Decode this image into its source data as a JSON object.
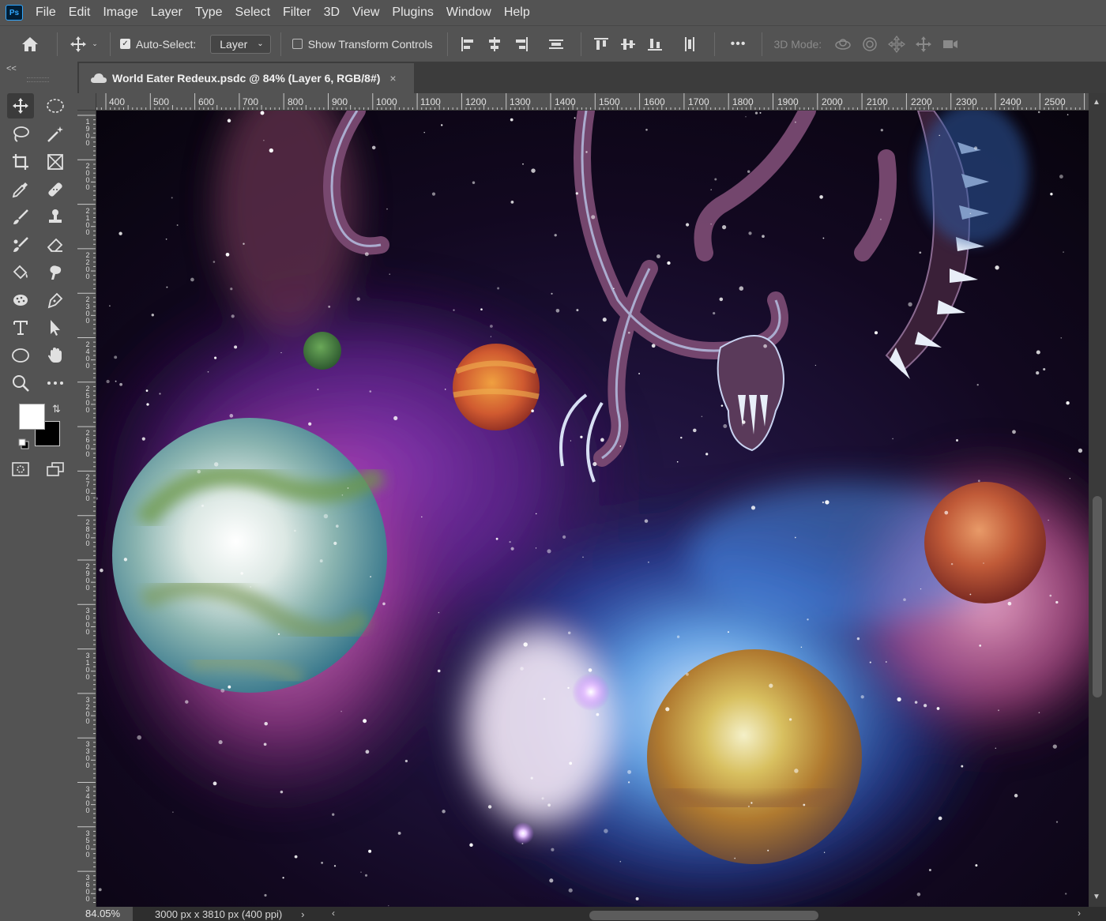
{
  "app": {
    "logo": "Ps"
  },
  "menu": [
    "File",
    "Edit",
    "Image",
    "Layer",
    "Type",
    "Select",
    "Filter",
    "3D",
    "View",
    "Plugins",
    "Window",
    "Help"
  ],
  "options": {
    "auto_select_label": "Auto-Select:",
    "auto_select_checked": true,
    "auto_select_target": "Layer",
    "transform_controls_label": "Show Transform Controls",
    "transform_controls_checked": false,
    "more_label": "•••",
    "mode_label": "3D Mode:"
  },
  "panel": {
    "collapse_label": "<<"
  },
  "document": {
    "tab_title": "World Eater Redeux.psdc @ 84% (Layer 6, RGB/8#)",
    "close_label": "×"
  },
  "ruler_h": [
    "400",
    "500",
    "600",
    "700",
    "800",
    "900",
    "1000",
    "1100",
    "1200",
    "1300",
    "1400",
    "1500",
    "1600",
    "1700",
    "1800",
    "1900",
    "2000",
    "2100",
    "2200",
    "2300",
    "2400",
    "2500"
  ],
  "ruler_v": [
    "1900",
    "2000",
    "2100",
    "2200",
    "2300",
    "2400",
    "2500",
    "2600",
    "2700",
    "2800",
    "2900",
    "3000",
    "3100",
    "3200",
    "3300",
    "3400",
    "3500",
    "3600"
  ],
  "colors": {
    "foreground": "#ffffff",
    "background": "#000000",
    "ui_panel": "#535353",
    "ui_dark": "#282828"
  },
  "status": {
    "zoom": "84.05%",
    "doc_info": "3000 px x 3810 px (400 ppi)",
    "arrow": "›"
  },
  "tools": [
    {
      "name": "move-tool-icon"
    },
    {
      "name": "marquee-tool-icon"
    },
    {
      "name": "lasso-tool-icon"
    },
    {
      "name": "magic-wand-tool-icon"
    },
    {
      "name": "crop-tool-icon"
    },
    {
      "name": "frame-tool-icon"
    },
    {
      "name": "eyedropper-tool-icon"
    },
    {
      "name": "healing-brush-tool-icon"
    },
    {
      "name": "brush-tool-icon"
    },
    {
      "name": "clone-stamp-tool-icon"
    },
    {
      "name": "mixer-brush-tool-icon"
    },
    {
      "name": "eraser-tool-icon"
    },
    {
      "name": "paint-bucket-tool-icon"
    },
    {
      "name": "smudge-tool-icon"
    },
    {
      "name": "sponge-tool-icon"
    },
    {
      "name": "pen-tool-icon"
    },
    {
      "name": "type-tool-icon"
    },
    {
      "name": "path-selection-tool-icon"
    },
    {
      "name": "ellipse-tool-icon"
    },
    {
      "name": "hand-tool-icon"
    },
    {
      "name": "zoom-tool-icon"
    },
    {
      "name": "more-tools-icon"
    },
    {
      "name": "quick-mask-icon"
    },
    {
      "name": "screen-mode-icon"
    }
  ]
}
